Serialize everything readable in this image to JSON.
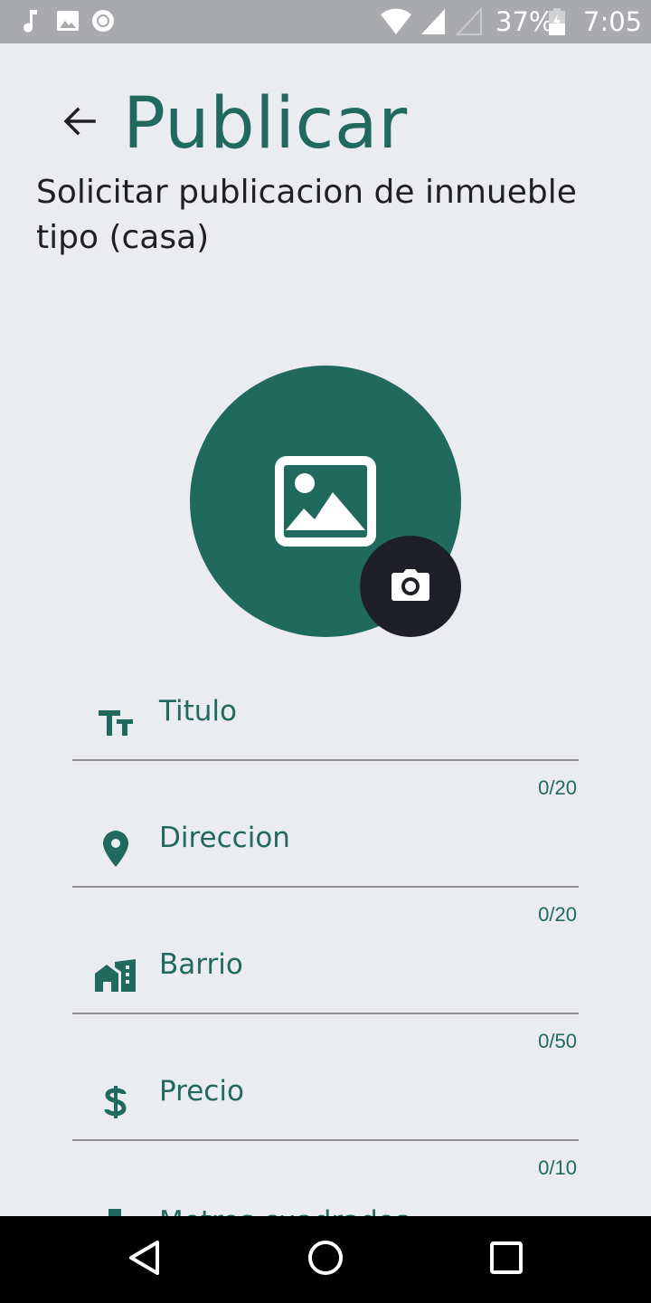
{
  "status_bar": {
    "battery": "37%",
    "time": "7:05",
    "left_icons": [
      "music-note-icon",
      "image-notification-icon",
      "record-icon"
    ],
    "right_icons": [
      "wifi-icon",
      "signal-icon",
      "signal-empty-icon",
      "battery-icon"
    ]
  },
  "header": {
    "title": "Publicar",
    "subtitle": "Solicitar publicacion de inmueble tipo (casa)",
    "back_icon": "arrow-back-icon"
  },
  "photo": {
    "placeholder_icon": "image-icon",
    "camera_icon": "camera-icon"
  },
  "form": {
    "fields": [
      {
        "label": "Titulo",
        "icon": "text-fields-icon",
        "counter": "0/20"
      },
      {
        "label": "Direccion",
        "icon": "location-pin-icon",
        "counter": "0/20"
      },
      {
        "label": "Barrio",
        "icon": "buildings-icon",
        "counter": "0/50"
      },
      {
        "label": "Precio",
        "icon": "dollar-icon",
        "counter": "0/10"
      }
    ],
    "partial_field_label": "Metros cuadrados"
  },
  "colors": {
    "accent": "#206a5d",
    "background": "#ebecf0",
    "camera_button": "#1f1f28",
    "status_bar": "#a9aaad",
    "nav_bar": "#000000"
  },
  "nav_bar": {
    "buttons": [
      "back-triangle-icon",
      "home-circle-icon",
      "recents-square-icon"
    ]
  }
}
